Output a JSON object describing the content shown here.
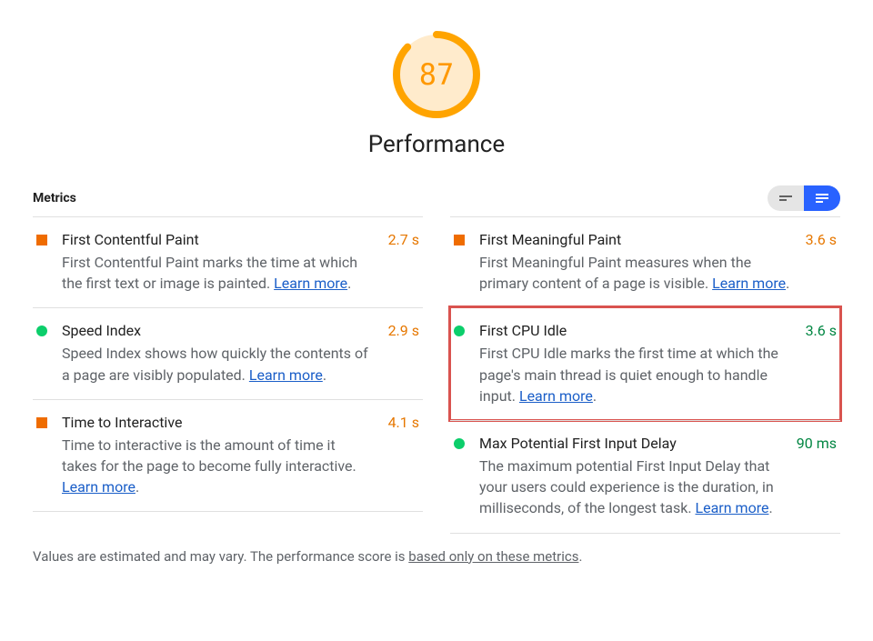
{
  "gauge": {
    "score": "87",
    "title": "Performance",
    "ring_color": "#ffa400",
    "bg_fill": "#ffebcc",
    "percent": 0.87
  },
  "metrics_label": "Metrics",
  "learn_more_label": "Learn more",
  "metrics": {
    "left": [
      {
        "status": "orange",
        "title": "First Contentful Paint",
        "desc_before": "First Contentful Paint marks the time at which the first text or image is painted. ",
        "value": "2.7 s",
        "value_class": "val-orange"
      },
      {
        "status": "green",
        "title": "Speed Index",
        "desc_before": "Speed Index shows how quickly the contents of a page are visibly populated. ",
        "value": "2.9 s",
        "value_class": "val-orange"
      },
      {
        "status": "orange",
        "title": "Time to Interactive",
        "desc_before": "Time to interactive is the amount of time it takes for the page to become fully interactive. ",
        "value": "4.1 s",
        "value_class": "val-orange"
      }
    ],
    "right": [
      {
        "status": "orange",
        "title": "First Meaningful Paint",
        "desc_before": "First Meaningful Paint measures when the primary content of a page is visible. ",
        "value": "3.6 s",
        "value_class": "val-orange"
      },
      {
        "status": "green",
        "title": "First CPU Idle",
        "desc_before": "First CPU Idle marks the first time at which the page's main thread is quiet enough to handle input. ",
        "value": "3.6 s",
        "value_class": "val-green",
        "highlighted": true
      },
      {
        "status": "green",
        "title": "Max Potential First Input Delay",
        "desc_before": "The maximum potential First Input Delay that your users could experience is the duration, in milliseconds, of the longest task. ",
        "value": "90 ms",
        "value_class": "val-green"
      }
    ]
  },
  "footnote": {
    "prefix": "Values are estimated and may vary. The performance score is ",
    "link": "based only on these metrics",
    "suffix": "."
  }
}
